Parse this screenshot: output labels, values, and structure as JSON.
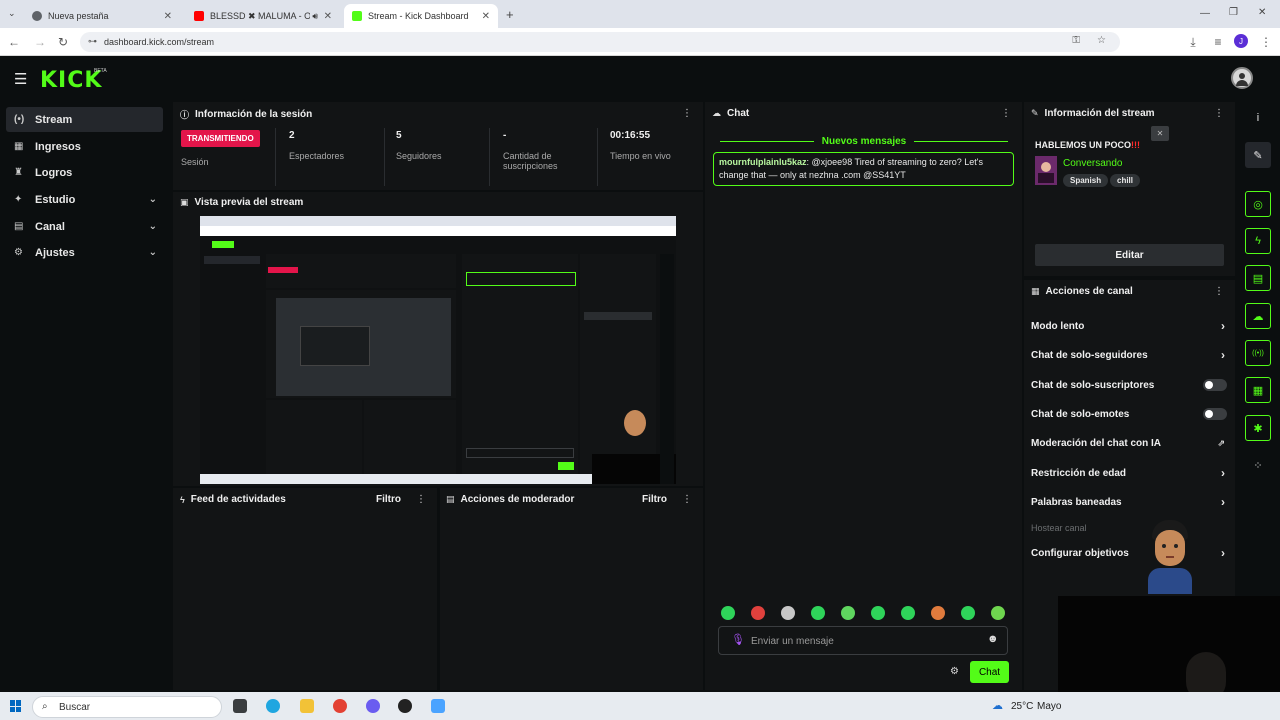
{
  "browser": {
    "tabs": [
      {
        "title": "Nueva pestaña",
        "icon": "chrome-icon",
        "color": "#5f6368"
      },
      {
        "title": "BLESSD ✖ MALUMA - OE",
        "icon": "youtube-icon",
        "color": "#ff0000"
      },
      {
        "title": "Stream - Kick Dashboard",
        "icon": "kick-icon",
        "color": "#53fc18"
      }
    ],
    "new_tab": "+",
    "url": "dashboard.kick.com/stream",
    "profile_initial": "J"
  },
  "app": {
    "logo": "KICK",
    "logo_badge": "BETA",
    "accent": "#53fc18"
  },
  "sidebar": {
    "items": [
      {
        "label": "Stream",
        "icon": "broadcast-icon",
        "glyph": "(•)"
      },
      {
        "label": "Ingresos",
        "icon": "revenue-icon",
        "glyph": "▦"
      },
      {
        "label": "Logros",
        "icon": "trophy-icon",
        "glyph": "♜"
      },
      {
        "label": "Estudio",
        "icon": "studio-icon",
        "glyph": "✦"
      },
      {
        "label": "Canal",
        "icon": "channel-icon",
        "glyph": "▤"
      },
      {
        "label": "Ajustes",
        "icon": "settings-icon",
        "glyph": "⚙"
      }
    ]
  },
  "session": {
    "title": "Información de la sesión",
    "badge": "TRANSMITIENDO",
    "badge_color": "#e3154a",
    "session_label": "Sesión",
    "stats": [
      {
        "value": "2",
        "label": "Espectadores"
      },
      {
        "value": "5",
        "label": "Seguidores"
      },
      {
        "value": "-",
        "label": "Cantidad de suscripciones"
      },
      {
        "value": "00:16:55",
        "label": "Tiempo en vivo"
      }
    ]
  },
  "preview": {
    "title": "Vista previa del stream"
  },
  "activity": {
    "title": "Feed de actividades",
    "filter": "Filtro"
  },
  "moderator": {
    "title": "Acciones de moderador",
    "filter": "Filtro"
  },
  "chat": {
    "title": "Chat",
    "new_messages": "Nuevos mensajes",
    "messages": [
      {
        "user": "mournfulplainlu5kaz",
        "text": "@xjoee98 Tired of streaming to zero? Let's change that — only at nezhna .com @SS41YT"
      }
    ],
    "input_placeholder": "Enviar un mensaje",
    "send_label": "Chat",
    "emote_colors": [
      "#2fd45a",
      "#e0413d",
      "#c7c7c7",
      "#2fd45a",
      "#5fd65f",
      "#2fd45a",
      "#2fd45a",
      "#e07b3d",
      "#2fd45a",
      "#6fd64f"
    ]
  },
  "stream_info": {
    "title": "Información del stream",
    "stream_title": "HABLEMOS UN POCO",
    "stream_title_marks": "!!!",
    "category": "Conversando",
    "tags": [
      "Spanish",
      "chill"
    ],
    "edit_label": "Editar"
  },
  "channel_actions": {
    "title": "Acciones de canal",
    "items": [
      {
        "label": "Modo lento",
        "control": "arrow"
      },
      {
        "label": "Chat de solo-seguidores",
        "control": "arrow"
      },
      {
        "label": "Chat de solo-suscriptores",
        "control": "toggle"
      },
      {
        "label": "Chat de solo-emotes",
        "control": "toggle"
      },
      {
        "label": "Moderación del chat con IA",
        "control": "external"
      },
      {
        "label": "Restricción de edad",
        "control": "arrow"
      },
      {
        "label": "Palabras baneadas",
        "control": "arrow"
      },
      {
        "label": "Hostear canal",
        "control": "none"
      },
      {
        "label": "Configurar objetivos",
        "control": "arrow"
      }
    ]
  },
  "rail": {
    "items": [
      {
        "icon": "info-icon",
        "glyph": "i"
      },
      {
        "icon": "edit-icon",
        "glyph": "✎"
      },
      {
        "icon": "target-icon",
        "glyph": "◎"
      },
      {
        "icon": "lightning-icon",
        "glyph": "ϟ"
      },
      {
        "icon": "clipboard-icon",
        "glyph": "▤"
      },
      {
        "icon": "chat-icon",
        "glyph": "☁"
      },
      {
        "icon": "broadcast-icon",
        "glyph": "((•))"
      },
      {
        "icon": "layout-icon",
        "glyph": "▦"
      },
      {
        "icon": "wrench-icon",
        "glyph": "✱"
      },
      {
        "icon": "apps-icon",
        "glyph": "⁘"
      }
    ]
  },
  "taskbar": {
    "search_placeholder": "Buscar",
    "weather": "25°C",
    "weather_extra": "Mayo"
  }
}
